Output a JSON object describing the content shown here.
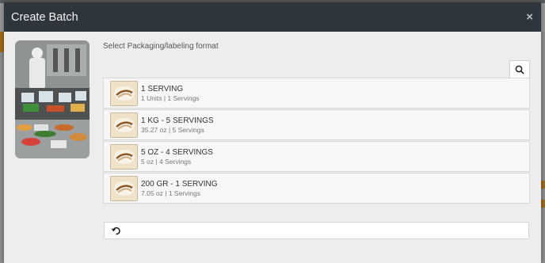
{
  "modal": {
    "title": "Create Batch",
    "close_label": "×",
    "prompt": "Select Packaging/labeling format"
  },
  "formats": [
    {
      "title": "1 SERVING",
      "subtitle": "1 Units | 1 Servings"
    },
    {
      "title": "1 KG - 5 SERVINGS",
      "subtitle": "35.27 oz | 5 Servings"
    },
    {
      "title": "5 OZ - 4 SERVINGS",
      "subtitle": "5 oz | 4 Servings"
    },
    {
      "title": "200 GR - 1 SERVING",
      "subtitle": "7.05 oz | 1 Servings"
    }
  ],
  "icons": {
    "search": "search-icon",
    "undo": "undo-icon",
    "close": "close-icon"
  },
  "colors": {
    "header": "#2e353d",
    "modal_bg": "#ededed"
  }
}
